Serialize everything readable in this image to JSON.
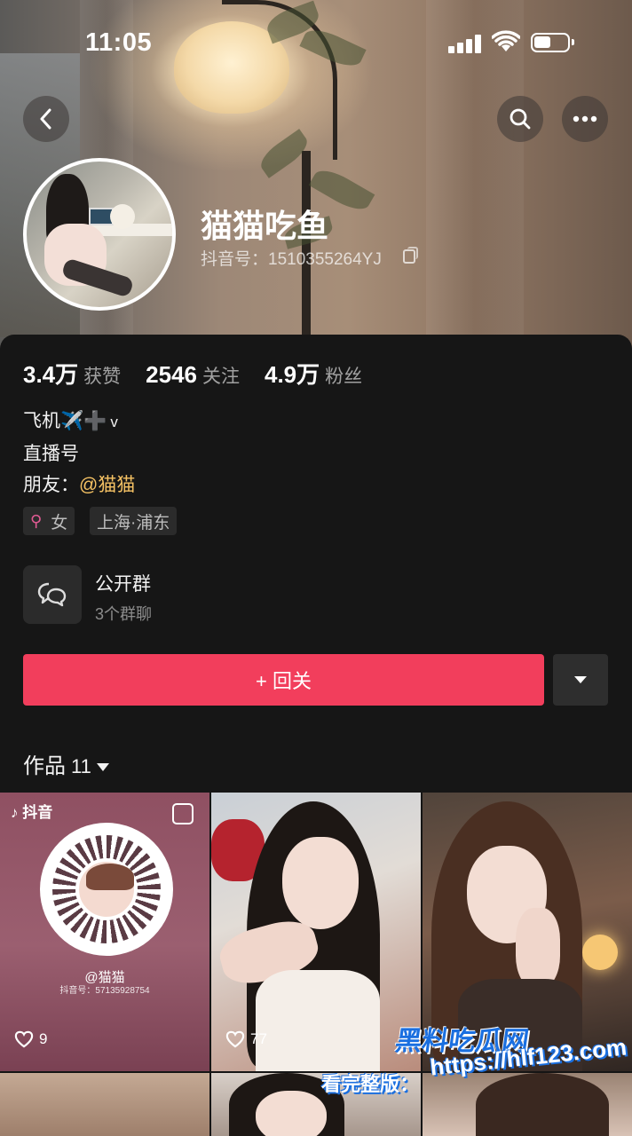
{
  "status_bar": {
    "time": "11:05"
  },
  "nav": {
    "back": "back-icon",
    "search": "search-icon",
    "more": "more-icon"
  },
  "profile": {
    "name": "猫猫吃鱼",
    "douyin_id": "抖音号：1510355264YJ"
  },
  "stats": [
    {
      "value": "3.4万",
      "label": "获赞"
    },
    {
      "value": "2546",
      "label": "关注"
    },
    {
      "value": "4.9万",
      "label": "粉丝"
    }
  ],
  "bio": {
    "line1_text": "飞机",
    "line1_plane": "✈️",
    "line1_plus": "➕",
    "line1_suffix": "v",
    "line2": "直播号",
    "line3_prefix": "朋友：",
    "line3_mention": "@猫猫"
  },
  "tags": {
    "gender": "女",
    "location": "上海·浦东"
  },
  "group": {
    "title": "公开群",
    "subtitle": "3个群聊"
  },
  "follow_button": "+ 回关",
  "works": {
    "label": "作品",
    "count": "11"
  },
  "grid": [
    {
      "likes": "9",
      "qr_name": "@猫猫",
      "qr_id": "抖音号：57135928754",
      "logo": "抖音"
    },
    {
      "likes": "77"
    },
    {
      "likes": ""
    }
  ],
  "watermark": {
    "brand": "黑料吃瓜网",
    "prefix": "看完整版：",
    "url": "https://hlf123.com"
  },
  "colors": {
    "accent": "#f23e5c",
    "background": "#161616",
    "mention": "#f5c264"
  }
}
